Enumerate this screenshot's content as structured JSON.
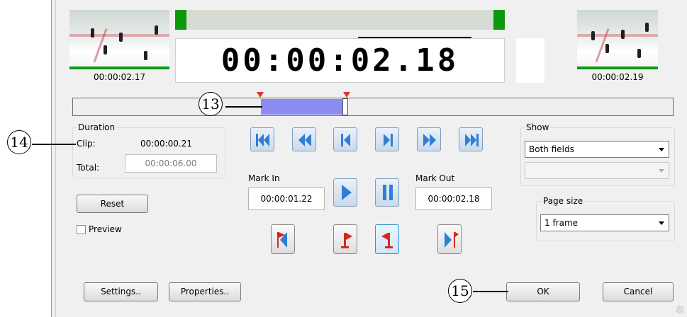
{
  "preview": {
    "left_timecode": "00:00:02.17",
    "center_timecode": "00:00:02.18",
    "right_timecode": "00:00:02.19"
  },
  "duration": {
    "title": "Duration",
    "clip_label": "Clip:",
    "clip_value": "00:00:00.21",
    "total_label": "Total:",
    "total_value": "00:00:06.00"
  },
  "buttons": {
    "reset": "Reset",
    "settings": "Settings..",
    "properties": "Properties..",
    "ok": "OK",
    "cancel": "Cancel"
  },
  "preview_checkbox": {
    "label": "Preview",
    "checked": false
  },
  "mark_in": {
    "label": "Mark In",
    "value": "00:00:01.22"
  },
  "mark_out": {
    "label": "Mark Out",
    "value": "00:00:02.18"
  },
  "show": {
    "title": "Show",
    "selected": "Both fields",
    "second_value": ""
  },
  "page_size": {
    "title": "Page size",
    "selected": "1 frame"
  },
  "callouts": {
    "c13": "13",
    "c14": "14",
    "c15": "15"
  },
  "colors": {
    "selection": "#8c8cf4",
    "nav_icon": "#2f7fd4",
    "flag": "#d8261f",
    "green_frame": "#0a9a0a"
  },
  "icons": [
    "go-to-start-icon",
    "fast-rewind-icon",
    "previous-frame-icon",
    "next-frame-icon",
    "fast-forward-icon",
    "go-to-end-icon",
    "play-icon",
    "pause-icon",
    "go-to-mark-in-icon",
    "set-mark-in-icon",
    "set-mark-out-icon",
    "go-to-mark-out-icon"
  ]
}
